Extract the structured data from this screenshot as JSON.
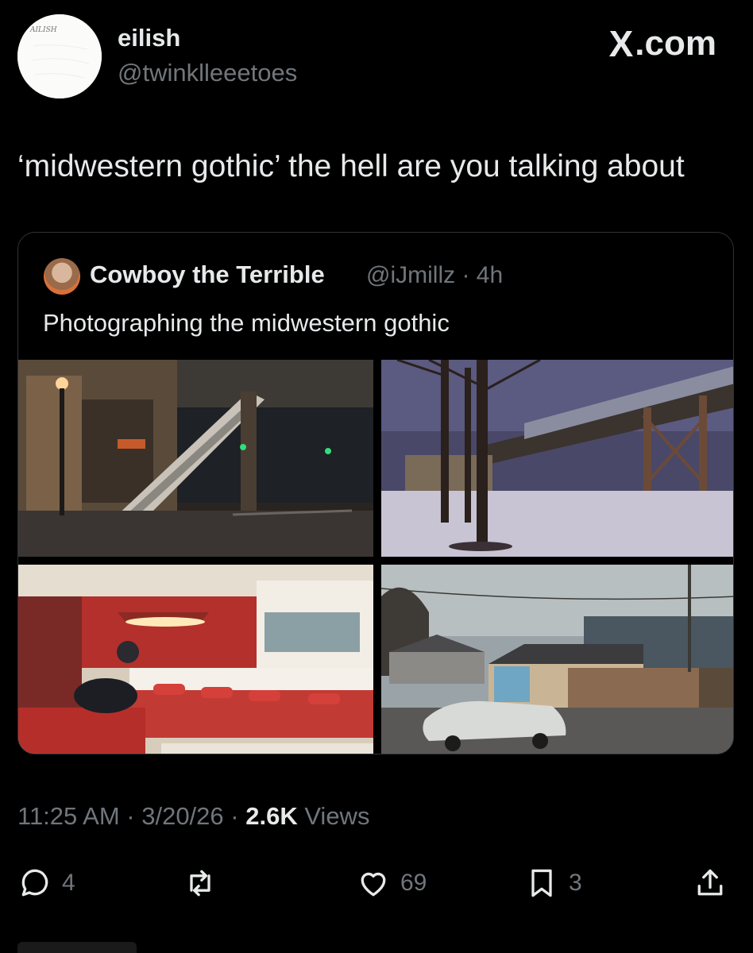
{
  "author": {
    "display_name": "eilish",
    "handle": "@twinklleeetoes",
    "avatar_text": "AILISH"
  },
  "brand": {
    "site": ".com",
    "mark": "X"
  },
  "tweet": {
    "text": "‘midwestern gothic’ the hell are you talking about"
  },
  "quote": {
    "name": "Cowboy the Terrible",
    "handle_time": "@iJmillz · 4h",
    "text": "Photographing the midwestern gothic"
  },
  "meta": {
    "time_date": "11:25 AM · 3/20/26 · ",
    "views_count": "2.6K",
    "views_label": " Views"
  },
  "actions": {
    "replies": "4",
    "reposts": "",
    "likes": "69",
    "bookmarks": "3"
  },
  "colors": {
    "background": "#000000",
    "text": "#e7e9ea",
    "muted": "#71767b",
    "border": "#2f3336"
  }
}
